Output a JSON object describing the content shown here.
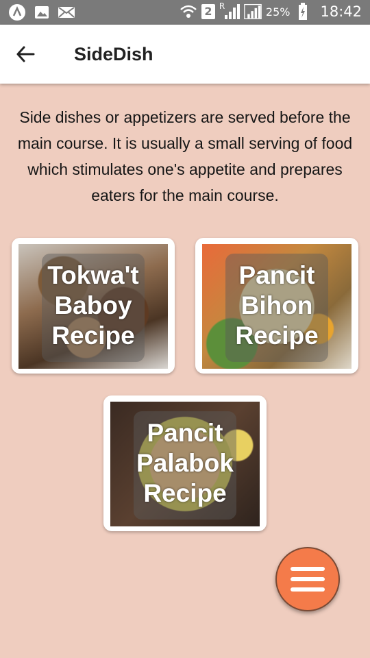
{
  "status_bar": {
    "icons_left": [
      "app-icon",
      "image-icon",
      "mail-icon"
    ],
    "icons_right": [
      "wifi-icon",
      "sim-2-icon",
      "signal-icon",
      "signal-full-icon"
    ],
    "sim_slot": "2",
    "roaming": "R",
    "battery_percent": "25%",
    "time": "18:42"
  },
  "app_bar": {
    "title": "SideDish",
    "back_icon": "arrow-left-icon"
  },
  "description": "Side dishes or appetizers are served before the main course. It is usually a small serving of food which stimulates one's appetite and prepares eaters for the main course.",
  "recipes": [
    {
      "label": "Tokwa't Baboy Recipe"
    },
    {
      "label": "Pancit Bihon Recipe"
    },
    {
      "label": "Pancit Palabok Recipe"
    }
  ],
  "fab": {
    "icon": "menu-icon",
    "color": "#f47b4a"
  },
  "colors": {
    "background": "#efcdbf",
    "status_bar": "#7a7a7a",
    "app_bar": "#ffffff"
  }
}
